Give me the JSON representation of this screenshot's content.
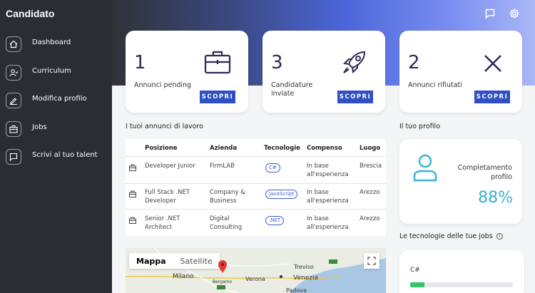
{
  "sidebar": {
    "title": "Candidato",
    "items": [
      {
        "label": "Dashboard",
        "icon": "home-icon"
      },
      {
        "label": "Curriculum",
        "icon": "user-icon"
      },
      {
        "label": "Modifica profilo",
        "icon": "edit-icon"
      },
      {
        "label": "Jobs",
        "icon": "briefcase-icon"
      },
      {
        "label": "Scrivi al tuo talent",
        "icon": "chat-icon"
      }
    ]
  },
  "header": {
    "icons": [
      "message-icon",
      "settings-icon"
    ]
  },
  "stats": [
    {
      "number": "1",
      "label": "Annunci pending",
      "button": "SCOPRI",
      "icon": "briefcase-icon"
    },
    {
      "number": "3",
      "label": "Candidature inviate",
      "button": "SCOPRI",
      "icon": "rocket-icon"
    },
    {
      "number": "2",
      "label": "Annunci rifiutati",
      "button": "SCOPRI",
      "icon": "close-icon"
    }
  ],
  "jobs": {
    "title": "I tuoi annunci di lavoro",
    "columns": [
      "Posizione",
      "Azienda",
      "Tecnologie",
      "Compenso",
      "Luogo"
    ],
    "rows": [
      {
        "posizione": "Developer Junior",
        "azienda": "FirmLAB",
        "tech": "C#",
        "compenso": "In base all'esperienza",
        "luogo": "Brescia"
      },
      {
        "posizione": "Full Stack .NET Developer",
        "azienda": "Company & Business",
        "tech": "JavaScript",
        "compenso": "In base all'esperienza",
        "luogo": "Arezzo"
      },
      {
        "posizione": "Senior .NET Architect",
        "azienda": "Digital Consulting",
        "tech": ".NET",
        "compenso": "In base all'esperienza",
        "luogo": "Arezzo"
      }
    ]
  },
  "map": {
    "tabs": [
      "Mappa",
      "Satellite"
    ],
    "active_tab": "Mappa",
    "places": [
      "Milano",
      "Verona",
      "Venezia",
      "Treviso",
      "Padova",
      "Bergamo"
    ]
  },
  "profile": {
    "title": "Il tuo profilo",
    "completion_label": "Completamento profilo",
    "completion_value": "88%",
    "completion_fraction": 0.88
  },
  "techs": {
    "title": "Le tecnologie delle tue jobs",
    "items": [
      {
        "name": "C#",
        "fraction": 0.14
      }
    ]
  },
  "colors": {
    "accent": "#2f4fc7",
    "teal": "#35b6d8",
    "sidebar": "#2b2d33",
    "progress": "#35c46b"
  }
}
